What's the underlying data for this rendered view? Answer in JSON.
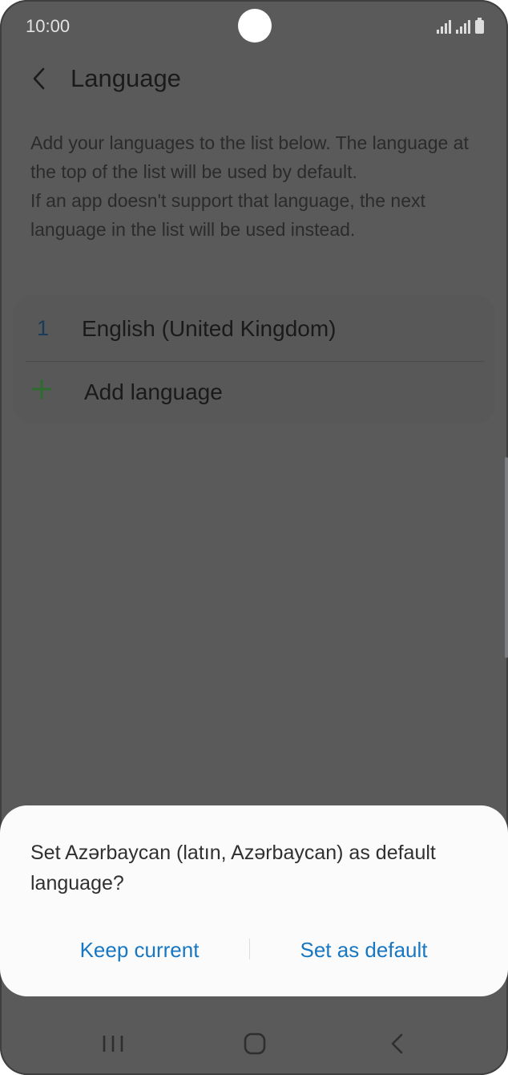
{
  "status_bar": {
    "time": "10:00"
  },
  "header": {
    "title": "Language",
    "back_icon": "chevron-left-icon"
  },
  "description": {
    "line1": "Add your languages to the list below. The language at the top of the list will be used by default.",
    "line2": "If an app doesn't support that language, the next language in the list will be used instead."
  },
  "languages": [
    {
      "number": "1",
      "name": "English (United Kingdom)"
    }
  ],
  "add_language": {
    "label": "Add language",
    "icon": "plus-icon"
  },
  "dialog": {
    "message": "Set Azərbaycan (latın, Azərbaycan) as default language?",
    "keep_label": "Keep current",
    "set_label": "Set as default"
  },
  "nav": {
    "recents_icon": "recents-icon",
    "home_icon": "home-icon",
    "back_icon": "back-icon"
  },
  "colors": {
    "accent": "#1777c2",
    "scrim_background": "#5a5a5a",
    "dialog_background": "#fbfbfb",
    "plus_green": "#2e7d32"
  }
}
